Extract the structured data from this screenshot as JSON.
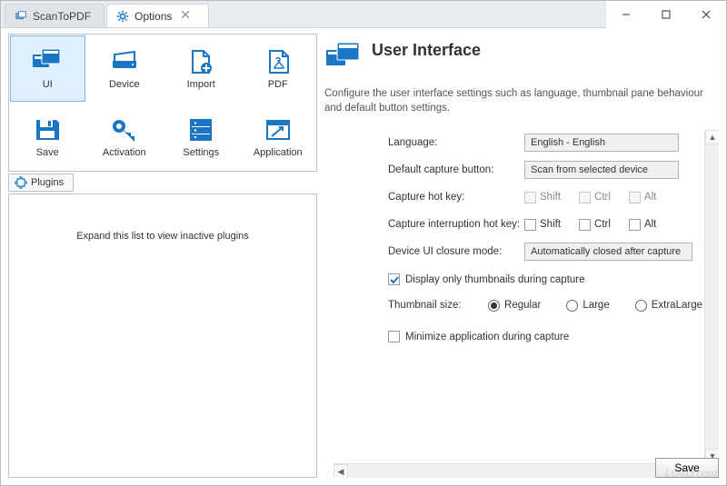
{
  "tabs": {
    "app": {
      "label": "ScanToPDF"
    },
    "options": {
      "label": "Options"
    }
  },
  "grid": {
    "ui": "UI",
    "device": "Device",
    "import": "Import",
    "pdf": "PDF",
    "save": "Save",
    "activation": "Activation",
    "settings": "Settings",
    "application": "Application"
  },
  "plugins_button": "Plugins",
  "plugins_panel_text": "Expand this list to view inactive plugins",
  "panel": {
    "title": "User Interface",
    "description": "Configure the user interface settings such as language, thumbnail pane behaviour and default button settings."
  },
  "form": {
    "language_label": "Language:",
    "language_value": "English - English",
    "default_capture_label": "Default capture button:",
    "default_capture_value": "Scan from selected device",
    "capture_hotkey_label": "Capture hot key:",
    "interrupt_hotkey_label": "Capture interruption hot key:",
    "device_ui_closure_label": "Device UI closure mode:",
    "device_ui_closure_value": "Automatically closed after capture",
    "shift": "Shift",
    "ctrl": "Ctrl",
    "alt": "Alt",
    "display_thumbs": "Display only thumbnails during capture",
    "thumb_size_label": "Thumbnail size:",
    "thumb_regular": "Regular",
    "thumb_large": "Large",
    "thumb_extralarge": "ExtraLarge",
    "minimize_app": "Minimize application during capture"
  },
  "save_button": "Save",
  "watermark": "LO4D.com"
}
